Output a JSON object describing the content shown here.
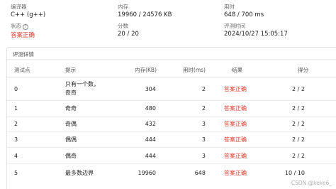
{
  "summary": {
    "compiler_label": "编译器",
    "compiler_value": "C++ (g++)",
    "memory_label": "内存",
    "memory_value": "19960 / 24576 KB",
    "time_label": "用时",
    "time_value": "648 / 700 ms",
    "status_label": "状态",
    "status_value": "答案正确",
    "score_label": "分数",
    "score_value": "20 / 20",
    "eval_time_label": "评测时间",
    "eval_time_value": "2024/10/27 15:05:17"
  },
  "details": {
    "title": "评测详情",
    "columns": [
      "测试点",
      "提示",
      "内存(KB)",
      "用时(ms)",
      "结果",
      "得分"
    ],
    "rows": [
      {
        "id": "0",
        "hint": "只有一个数，",
        "hint2": "奇奇",
        "memory": "304",
        "time": "2",
        "result": "答案正确",
        "score": "2 / 2"
      },
      {
        "id": "1",
        "hint": "奇奇",
        "hint2": "",
        "memory": "480",
        "time": "2",
        "result": "答案正确",
        "score": "2 / 2"
      },
      {
        "id": "2",
        "hint": "奇偶",
        "hint2": "",
        "memory": "432",
        "time": "3",
        "result": "答案正确",
        "score": "2 / 2"
      },
      {
        "id": "3",
        "hint": "偶偶",
        "hint2": "",
        "memory": "444",
        "time": "3",
        "result": "答案正确",
        "score": "2 / 2"
      },
      {
        "id": "4",
        "hint": "偶奇",
        "hint2": "",
        "memory": "444",
        "time": "3",
        "result": "答案正确",
        "score": "2 / 2"
      },
      {
        "id": "5",
        "hint": "最多数边界",
        "hint2": "",
        "memory": "19960",
        "time": "648",
        "result": "答案正确",
        "score": "10 / 10"
      }
    ]
  },
  "watermark": "CSDN @keke6_",
  "colors": {
    "accent_red": "#e23b2e"
  }
}
